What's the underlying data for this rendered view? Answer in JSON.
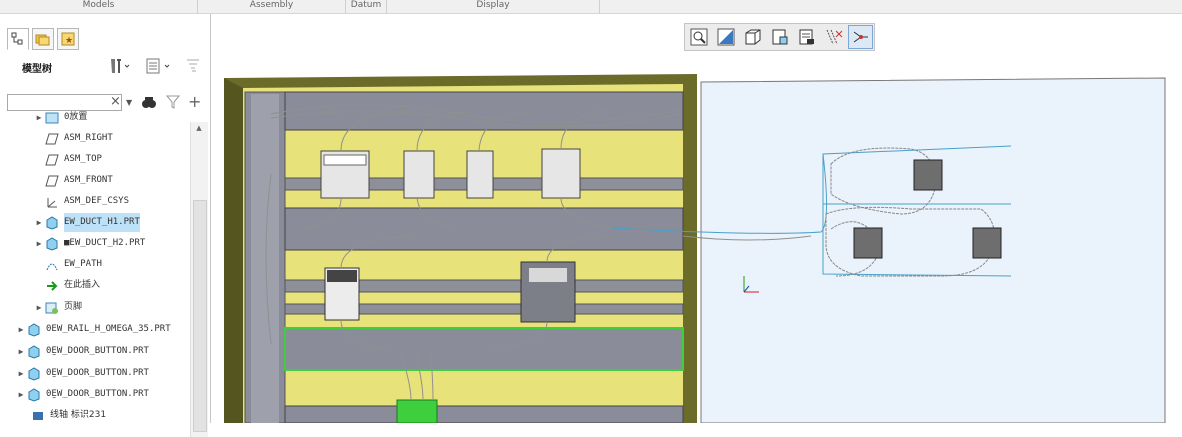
{
  "ribbon": {
    "groups": [
      {
        "label": "Models"
      },
      {
        "label": "Assembly"
      },
      {
        "label": "Datum"
      },
      {
        "label": "Display"
      }
    ]
  },
  "model_tree": {
    "title": "模型树",
    "search_value": "",
    "items": [
      {
        "label": "0放置",
        "icon": "folder-icon"
      },
      {
        "label": "ASM_RIGHT",
        "icon": "datum-plane-icon"
      },
      {
        "label": "ASM_TOP",
        "icon": "datum-plane-icon"
      },
      {
        "label": "ASM_FRONT",
        "icon": "datum-plane-icon"
      },
      {
        "label": "ASM_DEF_CSYS",
        "icon": "csys-icon"
      },
      {
        "label": "EW_DUCT_H1.PRT",
        "icon": "part-icon",
        "selected": true
      },
      {
        "label": "■EW_DUCT_H2.PRT",
        "icon": "part-icon"
      },
      {
        "label": "EW_PATH",
        "icon": "path-icon"
      },
      {
        "label": "在此插入",
        "icon": "insert-here-icon"
      },
      {
        "label": "页脚",
        "icon": "footer-icon"
      },
      {
        "label": "0EW_RAIL_H_OMEGA_35.PRT",
        "icon": "part-icon"
      },
      {
        "label": "0̰EW_DOOR_BUTTON.PRT",
        "icon": "part-icon"
      },
      {
        "label": "0̰EW_DOOR_BUTTON.PRT",
        "icon": "part-icon"
      },
      {
        "label": "0̰EW_DOOR_BUTTON.PRT",
        "icon": "part-icon"
      },
      {
        "label": "线轴  标识231",
        "icon": "spool-icon"
      }
    ]
  },
  "view_toolbar": {
    "buttons": [
      {
        "icon": "zoom-fit-icon"
      },
      {
        "icon": "display-style-icon"
      },
      {
        "icon": "saved-orientation-icon"
      },
      {
        "icon": "view-manager-icon"
      },
      {
        "icon": "perspective-icon"
      },
      {
        "icon": "datum-display-icon"
      },
      {
        "icon": "spin-center-icon",
        "active": true
      }
    ]
  },
  "colors": {
    "panel_yellow": "#e8e27a",
    "duct_grey": "#8a8c9a",
    "cabinet_olive": "#6b6b2a",
    "door_blue": "#eaf2fb",
    "wire": "#909090",
    "highlight_green": "#3ecf3e",
    "selected_row": "#bde1f7"
  }
}
